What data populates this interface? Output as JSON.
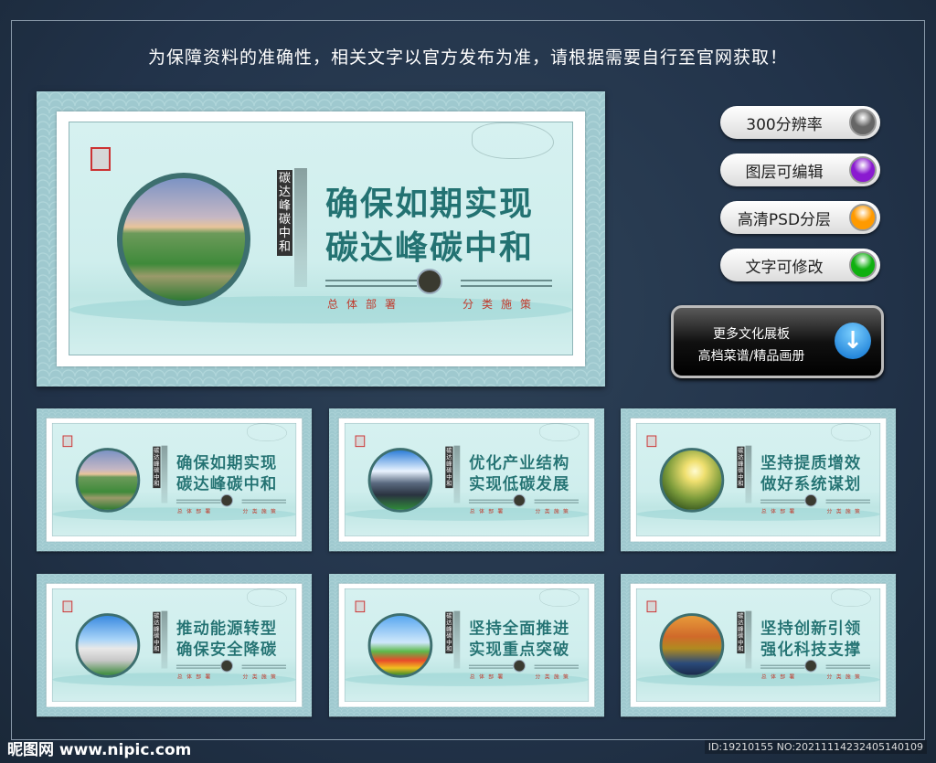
{
  "notice": "为保障资料的准确性，相关文字以官方发布为准，请根据需要自行至官网获取！",
  "main_board": {
    "line1": "确保如期实现",
    "line2": "碳达峰碳中和",
    "vertical": "碳达峰碳中和",
    "sub_left": "总体部署",
    "sub_right": "分类施策"
  },
  "thumbnails": [
    {
      "line1": "确保如期实现",
      "line2": "碳达峰碳中和"
    },
    {
      "line1": "优化产业结构",
      "line2": "实现低碳发展"
    },
    {
      "line1": "坚持提质增效",
      "line2": "做好系统谋划"
    },
    {
      "line1": "推动能源转型",
      "line2": "确保安全降碳"
    },
    {
      "line1": "坚持全面推进",
      "line2": "实现重点突破"
    },
    {
      "line1": "坚持创新引领",
      "line2": "强化科技支撑"
    }
  ],
  "features": [
    {
      "label": "300分辨率",
      "color": "#666666"
    },
    {
      "label": "图层可编辑",
      "color": "#8a1ad0"
    },
    {
      "label": "高清PSD分层",
      "color": "#ff9a00"
    },
    {
      "label": "文字可修改",
      "color": "#10b010"
    }
  ],
  "more_button": {
    "line1": "更多文化展板",
    "line2": "高档菜谱/精品画册",
    "icon": "download-arrow-icon"
  },
  "watermark": {
    "logo": "昵图网 www.nipic.com",
    "id": "ID:19210155 NO:20211114232405140109"
  }
}
